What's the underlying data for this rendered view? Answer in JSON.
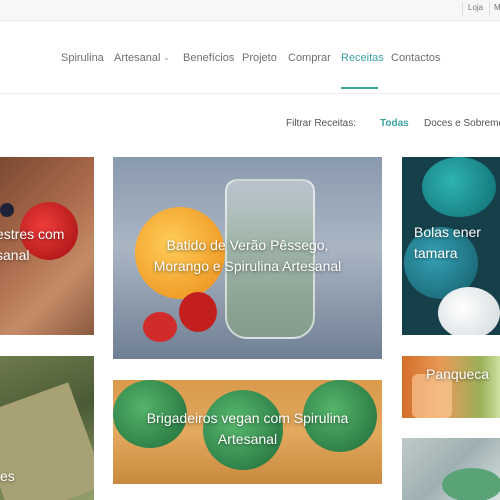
{
  "topbar": {
    "store_label": "Loja",
    "cut_label": "M"
  },
  "nav": {
    "items": [
      {
        "label": "Spirulina"
      },
      {
        "label": "Artesanal"
      },
      {
        "label": "Benefícios"
      },
      {
        "label": "Projeto"
      },
      {
        "label": "Comprar"
      },
      {
        "label": "Receitas"
      },
      {
        "label": "Contactos"
      }
    ],
    "active": "Receitas"
  },
  "filter": {
    "label": "Filtrar Receitas:",
    "options": [
      "Todas",
      "Doces e Sobreme"
    ],
    "active": "Todas"
  },
  "cards": [
    {
      "title": "estres com\nsanal"
    },
    {
      "title": "Batido de Verão Pêssego,\nMorango e Spirulina Artesanal"
    },
    {
      "title": "Bolas ener\ntamara"
    },
    {
      "title": "es"
    },
    {
      "title": "Brigadeiros vegan com Spirulina\nArtesanal"
    },
    {
      "title": "Panqueca"
    },
    {
      "title": ""
    }
  ],
  "colors": {
    "accent": "#3aa39f",
    "text": "#6f6f6f"
  }
}
